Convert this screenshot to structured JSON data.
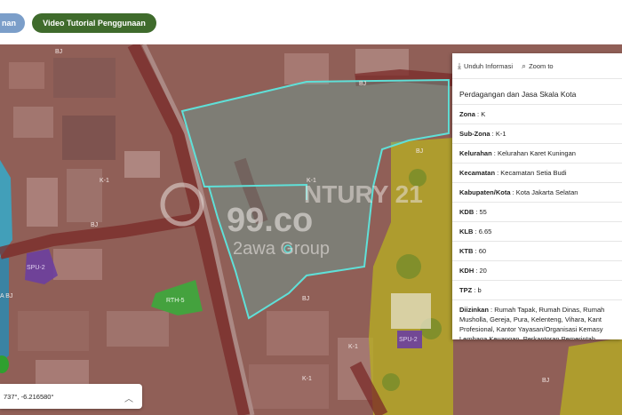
{
  "toolbar": {
    "left_button_label": "nan",
    "video_button_label": "Video Tutorial Penggunaan"
  },
  "map": {
    "labels": {
      "k1_west": "K-1",
      "k1_center": "K-1",
      "k1_south": "K-1",
      "k1_southeast": "K-1",
      "bj_center": "BJ",
      "bj_road": "BJ",
      "bj_east": "BJ",
      "bj_far_east": "BJ",
      "bj_north": "BJ",
      "bj_west": "BJ",
      "spu_west": "SPU-2",
      "spu_east": "SPU-2",
      "rth": "RTH-5",
      "aj_west": "A BJ"
    },
    "watermark": {
      "logo_text": "99.co",
      "brand_text": "2awa Group",
      "century_text": "NTURY 21"
    },
    "colors": {
      "zone_k": "#9a4b47",
      "zone_bj": "#a8a32d",
      "zone_spu": "#6b3fa0",
      "zone_rth": "#3caa3c",
      "highlight": "#5fe0d8"
    }
  },
  "panel": {
    "download_label": "Unduh Informasi",
    "download_icon": "download-icon",
    "zoom_label": "Zoom to",
    "zoom_icon": "zoom-icon",
    "title": "Perdagangan dan Jasa Skala Kota",
    "rows": [
      {
        "label": "Zona",
        "value": "K"
      },
      {
        "label": "Sub-Zona",
        "value": "K-1"
      },
      {
        "label": "Kelurahan",
        "value": "Kelurahan Karet Kuningan"
      },
      {
        "label": "Kecamatan",
        "value": "Kecamatan Setia Budi"
      },
      {
        "label": "Kabupaten/Kota",
        "value": "Kota Jakarta Selatan"
      },
      {
        "label": "KDB",
        "value": "55"
      },
      {
        "label": "KLB",
        "value": "6.65"
      },
      {
        "label": "KTB",
        "value": "60"
      },
      {
        "label": "KDH",
        "value": "20"
      },
      {
        "label": "TPZ",
        "value": "b"
      }
    ],
    "diizinkan_label": "Diizinkan",
    "diizinkan_value": "Rumah Tapak, Rumah Dinas, Rumah Musholla, Gereja, Pura, Kelenteng, Vihara, Kant Profesional, Kantor Yayasan/Organisasi Kemasy Lembaga Keuangan, Perkantoran Pemerintah"
  },
  "coordinates": {
    "text": "737°, -6.216580°",
    "chevron_icon": "chevron-up-icon"
  }
}
